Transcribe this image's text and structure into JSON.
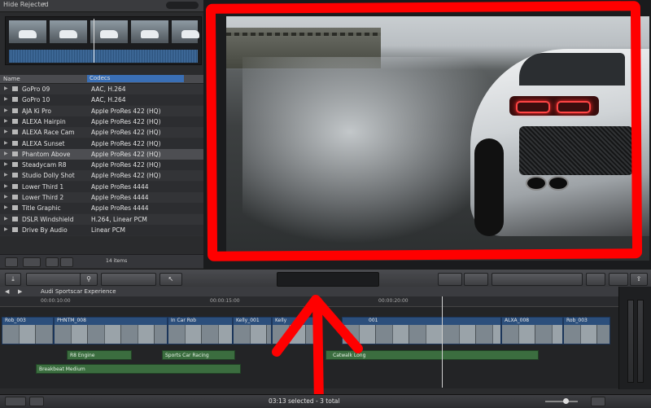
{
  "filter": {
    "label": "Hide Rejected",
    "arrow": "▾"
  },
  "list": {
    "header_name": "Name",
    "header_codecs": "Codecs",
    "rows": [
      {
        "name": "GoPro 09",
        "codec": "AAC, H.264"
      },
      {
        "name": "GoPro 10",
        "codec": "AAC, H.264"
      },
      {
        "name": "AJA Ki Pro",
        "codec": "Apple ProRes 422 (HQ)"
      },
      {
        "name": "ALEXA Hairpin",
        "codec": "Apple ProRes 422 (HQ)"
      },
      {
        "name": "ALEXA Race Cam",
        "codec": "Apple ProRes 422 (HQ)"
      },
      {
        "name": "ALEXA Sunset",
        "codec": "Apple ProRes 422 (HQ)"
      },
      {
        "name": "Phantom Above",
        "codec": "Apple ProRes 422 (HQ)"
      },
      {
        "name": "Steadycam R8",
        "codec": "Apple ProRes 422 (HQ)"
      },
      {
        "name": "Studio Dolly Shot",
        "codec": "Apple ProRes 422 (HQ)"
      },
      {
        "name": "Lower Third 1",
        "codec": "Apple ProRes 4444"
      },
      {
        "name": "Lower Third 2",
        "codec": "Apple ProRes 4444"
      },
      {
        "name": "Title Graphic",
        "codec": "Apple ProRes 4444"
      },
      {
        "name": "DSLR Windshield",
        "codec": "H.264, Linear PCM"
      },
      {
        "name": "Drive By Audio",
        "codec": "Linear PCM"
      }
    ],
    "items_count": "14 items"
  },
  "timeline": {
    "project_title": "Audi Sportscar Experience",
    "ruler": [
      "00:00:10:00",
      "00:00:15:00",
      "00:00:20:00"
    ],
    "clips": [
      {
        "label": "Rob_003"
      },
      {
        "label": "PHNTM_008"
      },
      {
        "label": "In Car Rob"
      },
      {
        "label": "Kelly_001"
      },
      {
        "label": "Kelly"
      },
      {
        "label": "001"
      },
      {
        "label": "ALXA_008"
      },
      {
        "label": "Rob_003"
      }
    ],
    "audio_clips": [
      {
        "label": "R8 Engine"
      },
      {
        "label": "Sports Car Racing"
      },
      {
        "label": "Catwalk Long"
      },
      {
        "label": "Breakbeat Medium"
      }
    ]
  },
  "status": {
    "text": "03:13 selected - 3 total"
  },
  "colors": {
    "annotation": "#ff0000",
    "selection": "#3a6fb5"
  }
}
